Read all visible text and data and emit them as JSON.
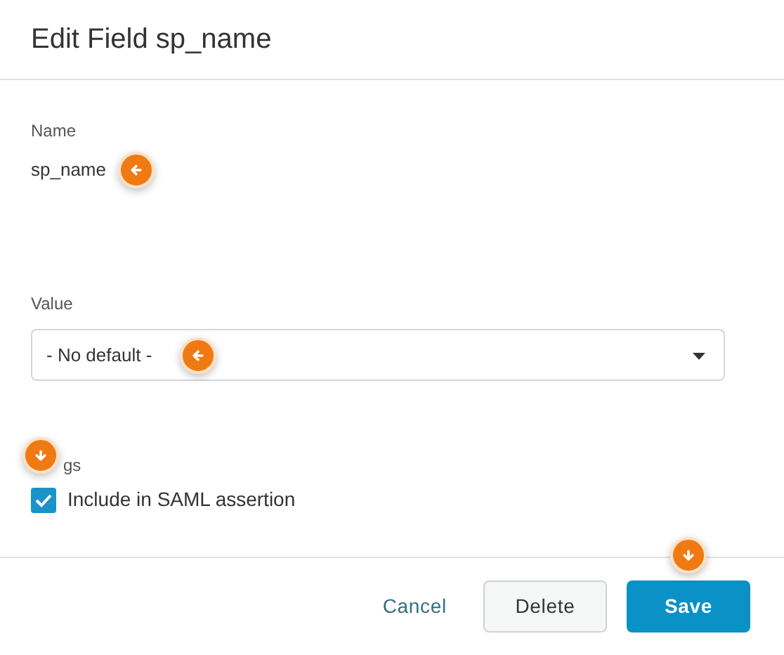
{
  "dialog": {
    "title": "Edit Field sp_name"
  },
  "name": {
    "label": "Name",
    "value": "sp_name",
    "callout": true
  },
  "value": {
    "label": "Value",
    "selected_value": "- No default -",
    "callout": true
  },
  "flags": {
    "label": "gs",
    "callout": true,
    "options": [
      {
        "label": "Include in SAML assertion",
        "checked": true
      }
    ]
  },
  "buttons": [
    {
      "label": "Cancel",
      "kind": "link"
    },
    {
      "label": "Delete",
      "kind": "secondary"
    },
    {
      "label": "Save",
      "kind": "primary",
      "callout": true
    }
  ]
}
